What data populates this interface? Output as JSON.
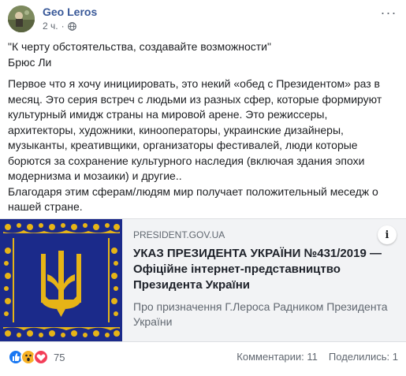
{
  "post": {
    "author": "Geo Leros",
    "time": "2 ч.",
    "more": "···",
    "paragraphs": [
      "\"К черту обстоятельства, создавайте возможности\"",
      "Брюс Ли",
      "Первое что я хочу инициировать, это некий «обед с Президентом» раз в месяц. Это серия встреч с людьми из разных сфер, которые формируют культурный имидж страны на мировой арене. Это режиссеры, архитекторы, художники, кинооператоры, украинские дизайнеры, музыканты, креативщики, организаторы фестивалей, люди которые борются за сохранение культурного наследия (включая здания эпохи модернизма и мозаики) и другие..",
      "Благодаря этим сферам/людям мир получает положительный меседж о нашей стране."
    ]
  },
  "link": {
    "domain": "PRESIDENT.GOV.UA",
    "title": "УКАЗ ПРЕЗИДЕНТА УКРАЇНИ №431/2019 — Офіційне інтернет-представництво Президента України",
    "description": "Про призначення Г.Лероса Радником Президента України",
    "info": "i",
    "image_colors": {
      "background": "#1b2a8a",
      "ornament": "#e6b417"
    }
  },
  "footer": {
    "reactions": [
      "like-icon",
      "wow-icon",
      "love-icon"
    ],
    "reaction_count": "75",
    "comments": "Комментарии: 11",
    "shares": "Поделились: 1"
  },
  "colors": {
    "author": "#385898",
    "secondary": "#606770",
    "like": "#1877f2",
    "love": "#f33e58",
    "wow": "#f7b125"
  }
}
